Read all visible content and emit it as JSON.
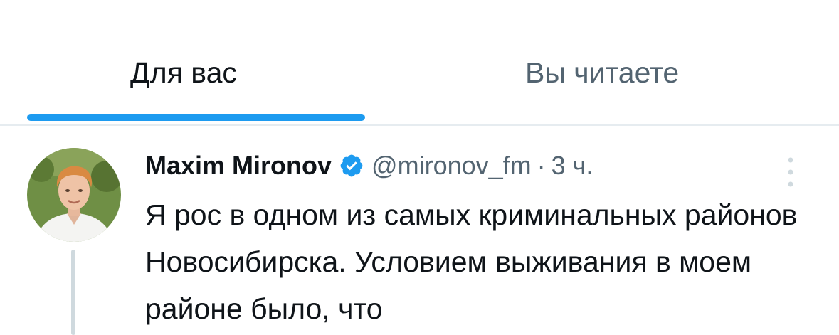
{
  "tabs": [
    {
      "label": "Для вас",
      "active": true
    },
    {
      "label": "Вы читаете",
      "active": false
    }
  ],
  "colors": {
    "accent": "#1d9bf0",
    "text_primary": "#0f1419",
    "text_secondary": "#536471"
  },
  "tweet": {
    "author_name": "Maxim Mironov",
    "verified": true,
    "verified_icon": "verified-badge-icon",
    "handle": "@mironov_fm",
    "separator": "·",
    "timestamp": "3 ч.",
    "more_icon": "more-options-icon",
    "text": "Я рос в одном из самых криминальных районов Новосибирска. Условием выживания в моем районе было, что"
  }
}
